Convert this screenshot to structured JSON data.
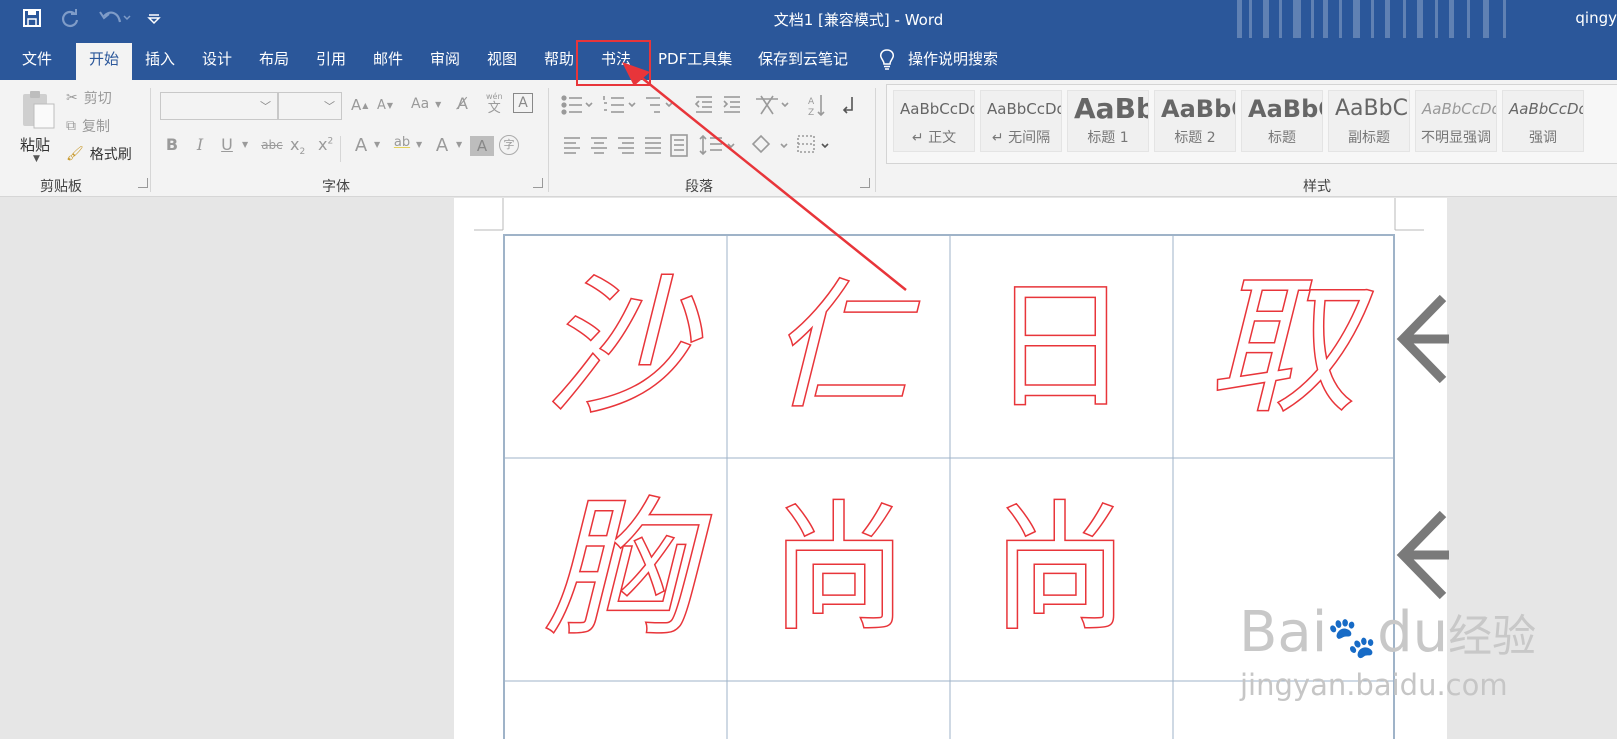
{
  "window": {
    "title": "文档1 [兼容模式]  -  Word",
    "user": "qingy"
  },
  "tabs": [
    {
      "label": "文件",
      "active": false
    },
    {
      "label": "开始",
      "active": true
    },
    {
      "label": "插入",
      "active": false
    },
    {
      "label": "设计",
      "active": false
    },
    {
      "label": "布局",
      "active": false
    },
    {
      "label": "引用",
      "active": false
    },
    {
      "label": "邮件",
      "active": false
    },
    {
      "label": "审阅",
      "active": false
    },
    {
      "label": "视图",
      "active": false
    },
    {
      "label": "帮助",
      "active": false
    },
    {
      "label": "书法",
      "active": false,
      "highlighted": true
    },
    {
      "label": "PDF工具集",
      "active": false
    },
    {
      "label": "保存到云笔记",
      "active": false
    }
  ],
  "tell_me": "操作说明搜索",
  "clipboard": {
    "paste": "粘贴",
    "cut": "剪切",
    "copy": "复制",
    "format_painter": "格式刷",
    "group_label": "剪贴板"
  },
  "font_group": {
    "group_label": "字体",
    "grow": "A",
    "shrink": "A",
    "case": "Aa",
    "phonetic_top": "wén",
    "phonetic_bottom": "文",
    "border_char": "A",
    "bold": "B",
    "italic": "I",
    "underline": "U",
    "strike": "abc",
    "subscript": "x",
    "superscript": "x",
    "sub_mark": "2",
    "sup_mark": "2",
    "effects": "A",
    "highlight": "ab",
    "font_color": "A",
    "shading": "A",
    "enclose": "字"
  },
  "paragraph_group": {
    "group_label": "段落"
  },
  "styles_group": {
    "group_label": "样式",
    "items": [
      {
        "sample": "AaBbCcDd",
        "name": "↵ 正文"
      },
      {
        "sample": "AaBbCcDd",
        "name": "↵ 无间隔"
      },
      {
        "sample": "AaBb",
        "name": "标题 1"
      },
      {
        "sample": "AaBbC",
        "name": "标题 2"
      },
      {
        "sample": "AaBbC",
        "name": "标题"
      },
      {
        "sample": "AaBbC",
        "name": "副标题"
      },
      {
        "sample": "AaBbCcDd",
        "name": "不明显强调"
      },
      {
        "sample": "AaBbCcDd",
        "name": "强调"
      }
    ]
  },
  "calligraphy_grid": {
    "rows": [
      [
        "沙",
        "仁",
        "日",
        "取"
      ],
      [
        "胸",
        "尚",
        "尚",
        ""
      ],
      [
        "",
        "",
        "",
        ""
      ]
    ]
  },
  "watermark": {
    "brand": "Bai",
    "brand2": "du",
    "cn": "经验",
    "url": "jingyan.baidu.com"
  },
  "colors": {
    "accent": "#2b579a",
    "annotation": "#e8353a",
    "calligraphy_stroke": "#e8353a",
    "grid_line": "#9fb3c8"
  }
}
